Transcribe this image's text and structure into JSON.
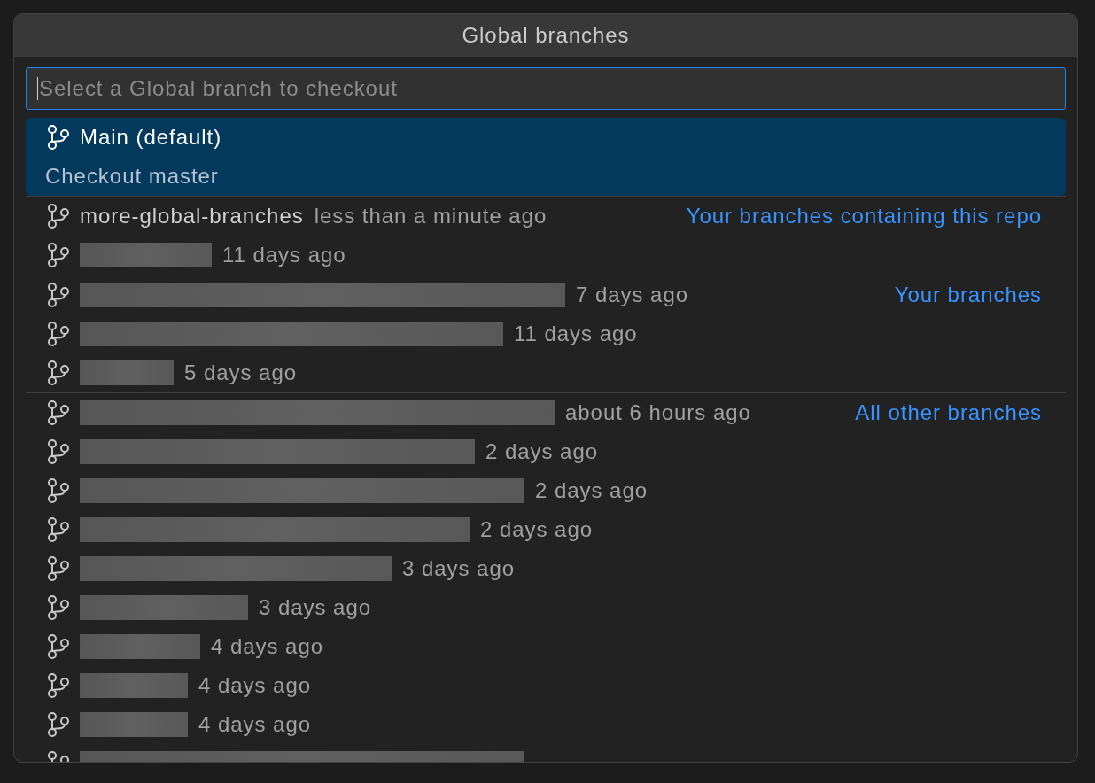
{
  "title": "Global branches",
  "input": {
    "placeholder": "Select a Global branch to checkout",
    "focused": true
  },
  "groups": [
    {
      "items": [
        {
          "kind": "named",
          "name": "Main (default)",
          "detail": "Checkout master",
          "selected": true
        }
      ]
    },
    {
      "label": "Your branches containing this repo",
      "items": [
        {
          "kind": "named",
          "name": "more-global-branches",
          "time": "less than a minute ago",
          "selected": false
        },
        {
          "kind": "redacted",
          "time": "11 days ago",
          "selected": false
        }
      ]
    },
    {
      "label": "Your branches",
      "items": [
        {
          "kind": "redacted",
          "time": "7 days ago",
          "selected": false
        },
        {
          "kind": "redacted",
          "time": "11 days ago",
          "selected": false
        },
        {
          "kind": "redacted",
          "time": "5 days ago",
          "selected": false
        }
      ]
    },
    {
      "label": "All other branches",
      "items": [
        {
          "kind": "redacted",
          "time": "about 6 hours ago",
          "selected": false
        },
        {
          "kind": "redacted",
          "time": "2 days ago",
          "selected": false
        },
        {
          "kind": "redacted",
          "time": "2 days ago",
          "selected": false
        },
        {
          "kind": "redacted",
          "time": "2 days ago",
          "selected": false
        },
        {
          "kind": "redacted",
          "time": "3 days ago",
          "selected": false
        },
        {
          "kind": "redacted",
          "time": "3 days ago",
          "selected": false
        },
        {
          "kind": "redacted",
          "time": "4 days ago",
          "selected": false
        },
        {
          "kind": "redacted",
          "time": "4 days ago",
          "selected": false
        },
        {
          "kind": "redacted",
          "time": "4 days ago",
          "selected": false
        },
        {
          "kind": "redacted",
          "selected": false
        }
      ]
    }
  ]
}
